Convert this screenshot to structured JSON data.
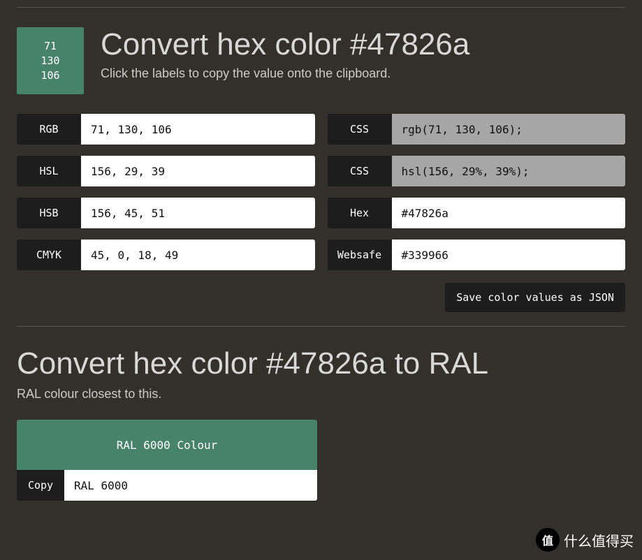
{
  "color": {
    "hex": "#47826a",
    "swatch_rgb": [
      "71",
      "130",
      "106"
    ]
  },
  "header": {
    "title": "Convert hex color #47826a",
    "subtitle": "Click the labels to copy the value onto the clipboard."
  },
  "fields": {
    "rgb": {
      "label": "RGB",
      "value": "71, 130, 106"
    },
    "css_rgb": {
      "label": "CSS",
      "value": "rgb(71, 130, 106);"
    },
    "hsl": {
      "label": "HSL",
      "value": "156, 29, 39"
    },
    "css_hsl": {
      "label": "CSS",
      "value": "hsl(156, 29%, 39%);"
    },
    "hsb": {
      "label": "HSB",
      "value": "156, 45, 51"
    },
    "hex": {
      "label": "Hex",
      "value": "#47826a"
    },
    "cmyk": {
      "label": "CMYK",
      "value": "45, 0, 18, 49"
    },
    "websafe": {
      "label": "Websafe",
      "value": "#339966"
    }
  },
  "save_btn": "Save color values as JSON",
  "ral": {
    "title": "Convert hex color #47826a to RAL",
    "subtitle": "RAL colour closest to this.",
    "button": "RAL 6000 Colour",
    "copy_label": "Copy",
    "copy_value": "RAL 6000"
  },
  "watermark": {
    "badge": "值",
    "text": "什么值得买"
  }
}
